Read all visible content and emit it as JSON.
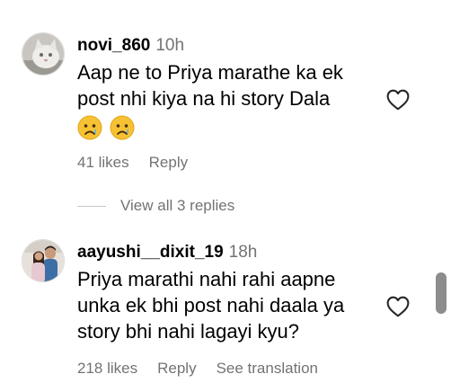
{
  "comments": [
    {
      "username": "novi_860",
      "time": "10h",
      "text": "Aap ne to Priya marathe ka ek post nhi kiya na hi story Dala",
      "emojis": [
        "crying-face",
        "crying-face"
      ],
      "likes": "41 likes",
      "reply": "Reply",
      "view_replies": "View all 3 replies"
    },
    {
      "username": "aayushi__dixit_19",
      "time": "18h",
      "text": "Priya marathi nahi rahi aapne unka ek bhi post nahi daala ya story bhi nahi lagayi kyu?",
      "likes": "218 likes",
      "reply": "Reply",
      "translation": "See translation"
    }
  ],
  "colors": {
    "secondary_text": "#737373",
    "scrollbar": "#8d8d8d",
    "divider": "#c7c7c7"
  },
  "icons": [
    "heart-icon",
    "sad-tear-emoji"
  ]
}
